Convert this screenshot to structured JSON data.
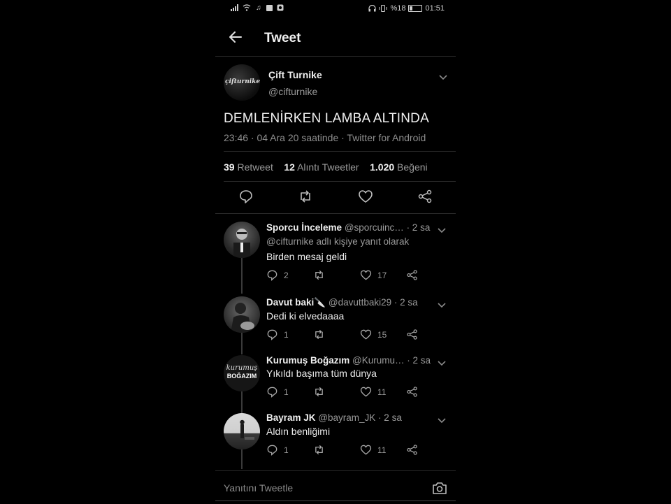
{
  "status_bar": {
    "battery_text": "%18",
    "time": "01:51"
  },
  "header": {
    "title": "Tweet"
  },
  "main_tweet": {
    "author_name": "Çift Turnike",
    "author_handle": "@cifturnike",
    "avatar_text": "çifturnike",
    "text": "DEMLENİRKEN LAMBA ALTINDA",
    "meta": "23:46 · 04 Ara 20 saatinde · Twitter for Android",
    "retweets": "39",
    "retweets_label": "Retweet",
    "quotes": "12",
    "quotes_label": "Alıntı Tweetler",
    "likes": "1.020",
    "likes_label": "Beğeni"
  },
  "replies": [
    {
      "name": "Sporcu İnceleme",
      "handle": "@sporcuinc…",
      "time": "· 2 sa",
      "reply_to": "@cifturnike adlı kişiye yanıt olarak",
      "text": "Birden mesaj geldi",
      "reply_count": "2",
      "like_count": "17"
    },
    {
      "name": "Davut baki🔪",
      "handle": "@davuttbaki29",
      "time": "· 2 sa",
      "text": "Dedi ki elvedaaaa",
      "reply_count": "1",
      "like_count": "15"
    },
    {
      "name": "Kurumuş Boğazım",
      "handle": "@Kurumu…",
      "time": "· 2 sa",
      "avatar_text_1": "kurumuş",
      "avatar_text_2": "BOĞAZIM",
      "text": "Yıkıldı başıma tüm dünya",
      "reply_count": "1",
      "like_count": "11"
    },
    {
      "name": "Bayram JK",
      "handle": "@bayram_JK",
      "time": "· 2 sa",
      "text": "Aldın benliğimi",
      "reply_count": "1",
      "like_count": "11"
    }
  ],
  "compose": {
    "placeholder": "Yanıtını Tweetle"
  }
}
